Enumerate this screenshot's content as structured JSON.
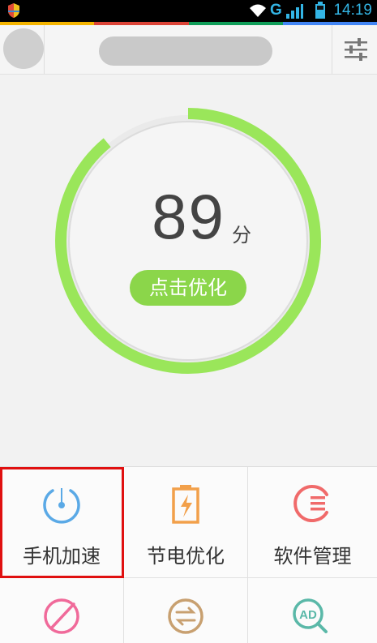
{
  "status_bar": {
    "network": "G",
    "time": "14:19"
  },
  "top_bar": {
    "avatar": "avatar",
    "settings_icon": "sliders-icon"
  },
  "score": {
    "value": "89",
    "unit": "分",
    "progress_percent": 89,
    "optimize_label": "点击优化"
  },
  "tools": [
    {
      "label": "手机加速",
      "icon": "speedometer-icon",
      "color": "#5aa9e6",
      "selected": true
    },
    {
      "label": "节电优化",
      "icon": "battery-bolt-icon",
      "color": "#f2a04a"
    },
    {
      "label": "软件管理",
      "icon": "app-list-icon",
      "color": "#f06a6a"
    },
    {
      "label": "",
      "icon": "clean-icon",
      "color": "#f06a9a"
    },
    {
      "label": "",
      "icon": "transfer-icon",
      "color": "#c8a070"
    },
    {
      "label": "",
      "icon": "ad-search-icon",
      "color": "#5ab8a8"
    }
  ],
  "colors": {
    "accent_green": "#8bd64a",
    "ring_green": "#9ae65a",
    "highlight_red": "#e01010"
  }
}
